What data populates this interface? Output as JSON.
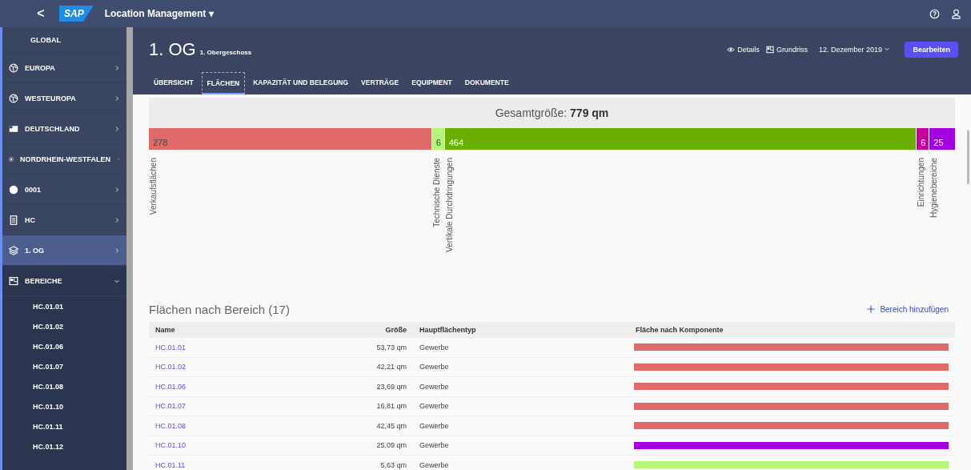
{
  "shell": {
    "back": "<",
    "logo": "SAP",
    "app_title": "Location Management ▾"
  },
  "sidebar": {
    "items": [
      {
        "label": "GLOBAL",
        "selected": false,
        "kind": "plain"
      },
      {
        "label": "EUROPA",
        "selected": false,
        "kind": "nav"
      },
      {
        "label": "WESTEUROPA",
        "selected": false,
        "kind": "nav"
      },
      {
        "label": "DEUTSCHLAND",
        "selected": false,
        "kind": "nav"
      },
      {
        "label": "NORDRHEIN-WESTFALEN",
        "selected": false,
        "kind": "nav"
      },
      {
        "label": "0001",
        "selected": false,
        "kind": "nav"
      },
      {
        "label": "HC",
        "selected": false,
        "kind": "nav"
      },
      {
        "label": "1. OG",
        "selected": true,
        "kind": "nav"
      },
      {
        "label": "BEREICHE",
        "selected": false,
        "kind": "group",
        "expanded": true,
        "children": [
          {
            "label": "HC.01.01"
          },
          {
            "label": "HC.01.02"
          },
          {
            "label": "HC.01.06"
          },
          {
            "label": "HC.01.07"
          },
          {
            "label": "HC.01.08"
          },
          {
            "label": "HC.01.10"
          },
          {
            "label": "HC.01.11"
          },
          {
            "label": "HC.01.12"
          }
        ]
      }
    ]
  },
  "header": {
    "title": "1. OG",
    "subtitle": "1. Obergeschoss",
    "actions": [
      {
        "label": "Details"
      },
      {
        "label": "Grundriss"
      }
    ],
    "date": "12. Dezember 2019",
    "edit_button": "Bearbeiten"
  },
  "tabs": [
    {
      "label": "ÜBERSICHT",
      "selected": false
    },
    {
      "label": "FLÄCHEN",
      "selected": true
    },
    {
      "label": "KAPAZITÄT UND BELEGUNG",
      "selected": false
    },
    {
      "label": "VERTRÄGE",
      "selected": false
    },
    {
      "label": "EQUIPMENT",
      "selected": false
    },
    {
      "label": "DOKUMENTE",
      "selected": false
    }
  ],
  "total": "Gesamtgröße: **779 qm**",
  "segments": [
    {
      "value": "278",
      "label": "Verkaufsflächen",
      "color": "#e06a6a"
    },
    {
      "value": "6",
      "label": "Technische Dienste",
      "color": "#b4f57a"
    },
    {
      "value": "464",
      "label": "Vertikale Durchdringungen",
      "color": "#6ab000"
    },
    {
      "value": "6",
      "label": "Einrichtungen",
      "color": "#c8009c"
    },
    {
      "value": "25",
      "label": "Hygienebereiche",
      "color": "#a200e0"
    }
  ],
  "section": {
    "title": "Flächen nach Bereich (17)",
    "add_button": "Bereich hinzufügen"
  },
  "table": {
    "columns": [
      "Name",
      "Größe",
      "Hauptflächentyp",
      "Fläche nach Komponente"
    ],
    "rows": [
      {
        "name": "HC.01.01",
        "size": "53,73 qm",
        "type": "Gewerbe",
        "color": "#e06a6a"
      },
      {
        "name": "HC.01.02",
        "size": "42,21 qm",
        "type": "Gewerbe",
        "color": "#e06a6a"
      },
      {
        "name": "HC.01.06",
        "size": "23,69 qm",
        "type": "Gewerbe",
        "color": "#e06a6a"
      },
      {
        "name": "HC.01.07",
        "size": "16,81 qm",
        "type": "Gewerbe",
        "color": "#e06a6a"
      },
      {
        "name": "HC.01.08",
        "size": "42,45 qm",
        "type": "Gewerbe",
        "color": "#e06a6a"
      },
      {
        "name": "HC.01.10",
        "size": "25,09 qm",
        "type": "Gewerbe",
        "color": "#a200e0"
      },
      {
        "name": "HC.01.11",
        "size": "5,63 qm",
        "type": "Gewerbe",
        "color": "#b4f57a"
      }
    ]
  }
}
